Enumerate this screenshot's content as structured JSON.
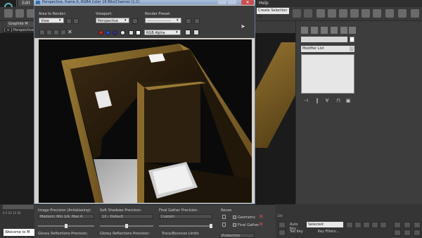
{
  "app": {
    "menu_edit": "Edit",
    "menu_help": "Help",
    "selection_set": "Create Selection Se",
    "ribbon_tab": "Graphite M",
    "viewport_label": "[ + ] Perspective",
    "maxscript": "Welcome to M",
    "track_numbers": "0    5    10    15    20",
    "track_end": "100"
  },
  "dialog": {
    "title": "Perspective, frame 0, RGBA Color 16 Bits/Channel (1:1)",
    "close_glyph": "✕",
    "area_label": "Area to Render:",
    "area_value": "View",
    "viewport_label": "Viewport:",
    "viewport_value": "Perspective",
    "preset_label": "Render Preset:",
    "preset_value": "-------------------",
    "channel_value": "RGB Alpha"
  },
  "render_panel": {
    "image_precision_label": "Image Precision (Antialiasing):",
    "image_precision_value": "Medium: Min 1/4, Max 4",
    "soft_shadows_label": "Soft Shadows Precision:",
    "soft_shadows_value": "1X - Default",
    "final_gather_label": "Final Gather Precision:",
    "final_gather_value": "Custom",
    "glossy_reflections_label": "Glossy Reflections Precision:",
    "glossy_reflections_label_2": "Glossy Reflections Precision:",
    "trace_bounces_label": "Trace/Bounces Limits",
    "reuse_label": "Reuse",
    "geometry_label": "Geometry",
    "final_gather_reuse_label": "Final Gather",
    "production_value": "Production"
  },
  "command_panel": {
    "modifier_list": "Modifier List"
  },
  "anim": {
    "auto_key": "Auto Key",
    "set_key": "Set Key",
    "selected": "Selected",
    "key_filters": "Key Filters..."
  },
  "colors": {
    "titlebar": "#8aa3c4",
    "dialog_bg": "#3c3c3c",
    "render_bg": "#0a0a0a",
    "wall": "#2a1d0c",
    "wood": "#8a6a2c",
    "close": "#c75050",
    "channel_red": "#d02020",
    "channel_green": "#2050d0",
    "channel_blue": "#303090"
  }
}
